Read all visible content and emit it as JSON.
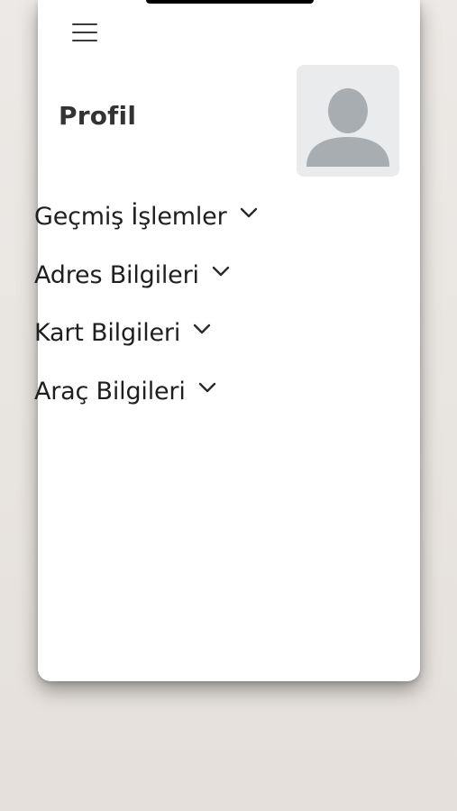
{
  "header": {
    "menu_icon": "hamburger-menu-icon",
    "title": "Profil"
  },
  "avatar": {
    "icon": "user-placeholder-icon",
    "background_color": "#e9ebed",
    "figure_color": "#a8adb1"
  },
  "menu": {
    "items": [
      {
        "label": "Geçmiş İşlemler",
        "icon": "chevron-down-icon"
      },
      {
        "label": "Adres Bilgileri",
        "icon": "chevron-down-icon"
      },
      {
        "label": "Kart Bilgileri",
        "icon": "chevron-down-icon"
      },
      {
        "label": "Araç Bilgileri",
        "icon": "chevron-down-icon"
      }
    ]
  }
}
